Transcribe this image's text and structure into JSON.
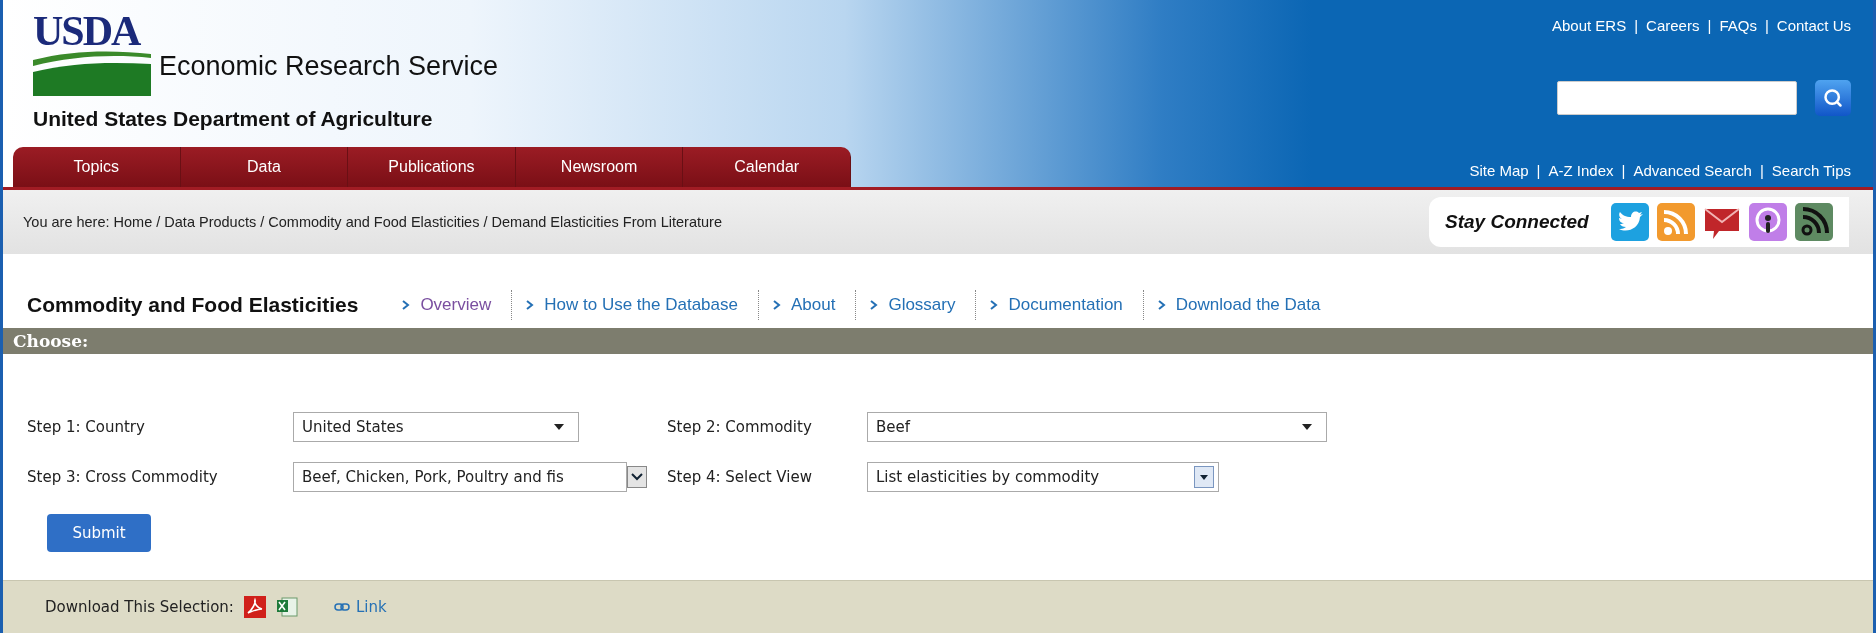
{
  "header": {
    "logo_text": "USDA",
    "agency": "Economic Research Service",
    "department": "United States Department of Agriculture",
    "top_links": {
      "separator": "|",
      "items": [
        "About ERS",
        "Careers",
        "FAQs",
        "Contact Us"
      ]
    },
    "bottom_links": {
      "separator": "|",
      "items": [
        "Site Map",
        "A-Z Index",
        "Advanced Search",
        "Search Tips"
      ]
    }
  },
  "main_nav": [
    {
      "label": "Topics"
    },
    {
      "label": "Data"
    },
    {
      "label": "Publications"
    },
    {
      "label": "Newsroom"
    },
    {
      "label": "Calendar"
    }
  ],
  "breadcrumb": "You are here: Home / Data Products / Commodity and Food Elasticities / Demand Elasticities From Literature",
  "stay_connected": {
    "label": "Stay Connected"
  },
  "section": {
    "title": "Commodity and Food Elasticities",
    "links": [
      {
        "label": "Overview",
        "selected": true
      },
      {
        "label": "How to Use the Database",
        "selected": false
      },
      {
        "label": "About",
        "selected": false
      },
      {
        "label": "Glossary",
        "selected": false
      },
      {
        "label": "Documentation",
        "selected": false
      },
      {
        "label": "Download the Data",
        "selected": false
      }
    ]
  },
  "form": {
    "title": "Choose:",
    "fields": [
      {
        "label": "Step 1: Country",
        "value": "United States",
        "kind": "plain"
      },
      {
        "label": "Step 2: Commodity",
        "value": "Beef",
        "kind": "plain"
      },
      {
        "label": "Step 3: Cross Commodity",
        "value": "Beef, Chicken, Pork, Poultry and fis",
        "kind": "boxed"
      },
      {
        "label": "Step 4: Select View",
        "value": "List elasticities by commodity",
        "kind": "boxed"
      }
    ],
    "submit": "Submit"
  },
  "download": {
    "label": "Download This Selection:",
    "link": "Link"
  }
}
